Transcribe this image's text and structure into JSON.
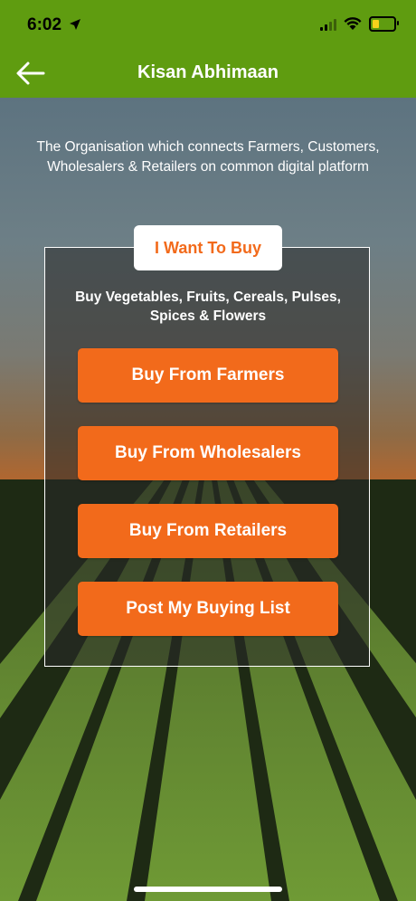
{
  "status_bar": {
    "time": "6:02"
  },
  "app_bar": {
    "title": "Kisan Abhimaan"
  },
  "tagline": "The Organisation which connects Farmers, Customers, Wholesalers & Retailers on common digital platform",
  "panel": {
    "label": "I Want To Buy",
    "subtitle": "Buy Vegetables, Fruits, Cereals, Pulses, Spices & Flowers",
    "buttons": [
      {
        "label": "Buy From Farmers"
      },
      {
        "label": "Buy From Wholesalers"
      },
      {
        "label": "Buy From Retailers"
      },
      {
        "label": "Post My Buying List"
      }
    ]
  },
  "colors": {
    "header": "#5f9c10",
    "accent": "#f26a1b",
    "battery": "#f6d21a"
  },
  "icons": {
    "back": "back-arrow-icon",
    "location": "location-arrow-icon",
    "signal": "signal-icon",
    "wifi": "wifi-icon",
    "battery": "battery-icon"
  },
  "battery_level": 0.3
}
